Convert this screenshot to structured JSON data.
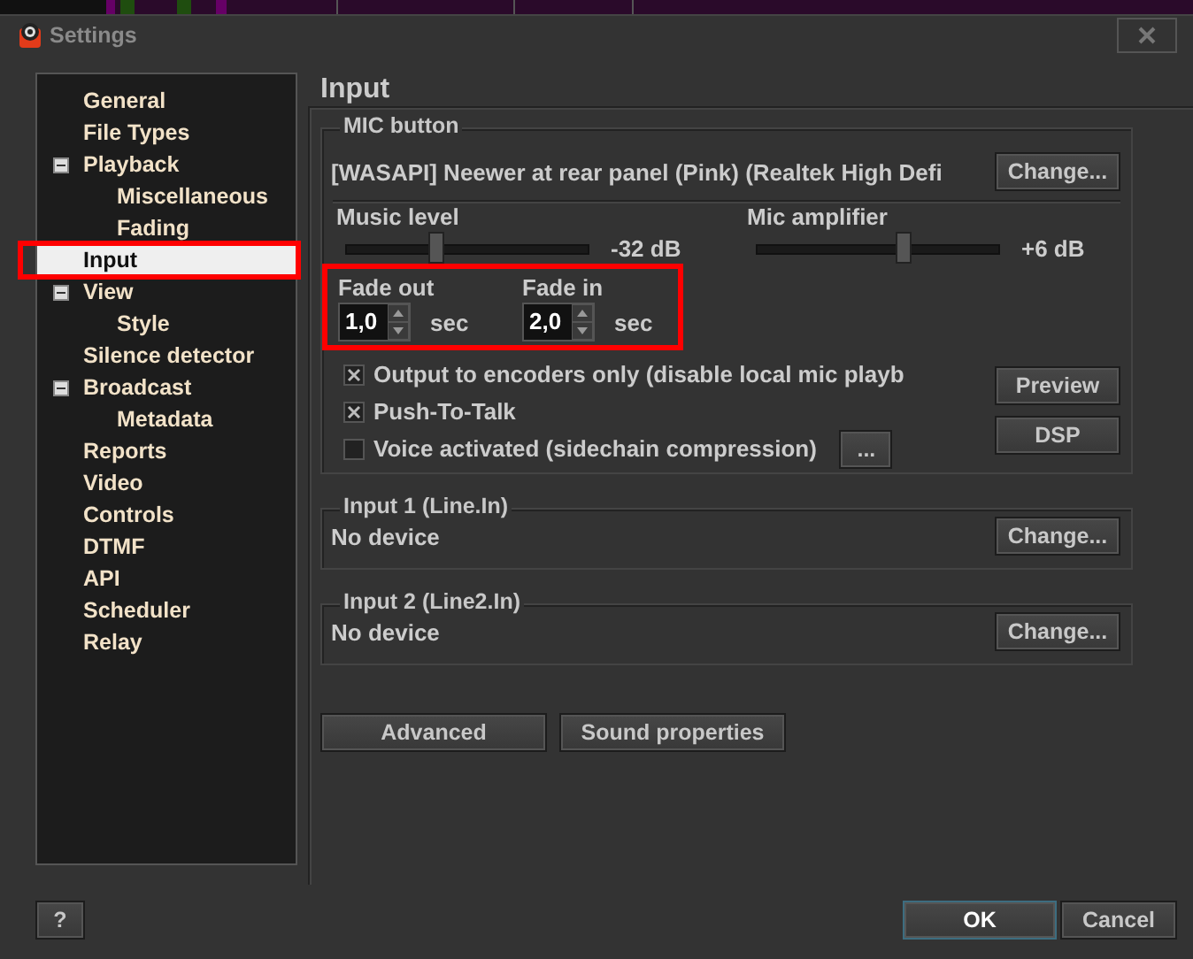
{
  "window": {
    "title": "Settings"
  },
  "sidebar": {
    "items": [
      {
        "label": "General",
        "selected": false
      },
      {
        "label": "File Types",
        "selected": false
      },
      {
        "label": "Playback",
        "selected": false,
        "expanded": true,
        "children": [
          {
            "label": "Miscellaneous",
            "selected": false
          },
          {
            "label": "Fading",
            "selected": false
          }
        ]
      },
      {
        "label": "Input",
        "selected": true
      },
      {
        "label": "View",
        "selected": false,
        "expanded": true,
        "children": [
          {
            "label": "Style",
            "selected": false
          }
        ]
      },
      {
        "label": "Silence detector",
        "selected": false
      },
      {
        "label": "Broadcast",
        "selected": false,
        "expanded": true,
        "children": [
          {
            "label": "Metadata",
            "selected": false
          }
        ]
      },
      {
        "label": "Reports",
        "selected": false
      },
      {
        "label": "Video",
        "selected": false
      },
      {
        "label": "Controls",
        "selected": false
      },
      {
        "label": "DTMF",
        "selected": false
      },
      {
        "label": "API",
        "selected": false
      },
      {
        "label": "Scheduler",
        "selected": false
      },
      {
        "label": "Relay",
        "selected": false
      }
    ]
  },
  "page": {
    "title": "Input",
    "mic_group": {
      "legend": "MIC button",
      "device": "[WASAPI] Neewer at rear panel (Pink) (Realtek High Defi",
      "change": "Change...",
      "music_level": {
        "label": "Music level",
        "level": 0.37,
        "reading": "-32 dB"
      },
      "mic_amplifier": {
        "label": "Mic amplifier",
        "level": 0.6,
        "reading": "+6 dB"
      },
      "fade_out": {
        "label": "Fade out",
        "value": "1,0",
        "unit": "sec"
      },
      "fade_in": {
        "label": "Fade in",
        "value": "2,0",
        "unit": "sec"
      },
      "options": [
        {
          "label": "Output to encoders only (disable local mic playb",
          "checked": true
        },
        {
          "label": "Push-To-Talk",
          "checked": true
        },
        {
          "label": "Voice activated (sidechain compression)",
          "checked": false,
          "more": "..."
        }
      ],
      "preview": "Preview",
      "dsp": "DSP"
    },
    "inputs": [
      {
        "legend": "Input 1 (Line.In)",
        "device": "No device",
        "change": "Change..."
      },
      {
        "legend": "Input 2 (Line2.In)",
        "device": "No device",
        "change": "Change..."
      }
    ],
    "buttons": [
      "Advanced",
      "Sound properties"
    ]
  },
  "footer": {
    "help": "?",
    "ok": "OK",
    "cancel": "Cancel"
  }
}
